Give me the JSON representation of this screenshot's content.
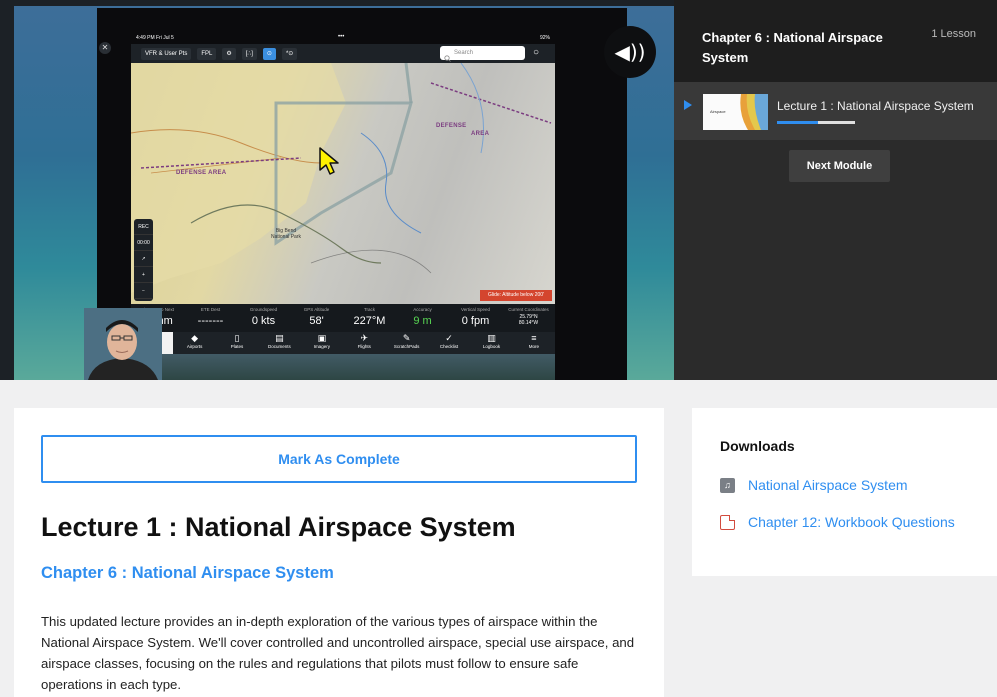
{
  "video": {
    "ipad": {
      "time": "4:49 PM  Fri Jul 5",
      "battery": "92%",
      "toolbar": [
        "VFR & User Pts",
        "FPL",
        "⚙",
        "[∴]",
        "⊙",
        "*⊙"
      ],
      "search_placeholder": "Search",
      "map_labels": {
        "defense_area_1": "DEFENSE AREA",
        "defense_area_2": "DEFENSE",
        "area": "AREA",
        "park": "Big Bend National Park"
      },
      "controls": [
        "REC",
        "00:00",
        "↗",
        "+",
        "−"
      ],
      "glide_warning": "Glide: Altitude below 200'",
      "instruments": [
        {
          "label": "Distance to Next",
          "value": "81 nm"
        },
        {
          "label": "ETE Dest",
          "value": "-------"
        },
        {
          "label": "Groundspeed",
          "value": "0 kts"
        },
        {
          "label": "GPS Altitude",
          "value": "58'"
        },
        {
          "label": "Track",
          "value": "227°M"
        },
        {
          "label": "Accuracy",
          "value": "9 m"
        },
        {
          "label": "Vertical Speed",
          "value": "0 fpm"
        },
        {
          "label": "Current Coordinates",
          "value": "25.79°N\n80.14°W"
        }
      ],
      "tabs": [
        "Maps",
        "Airports",
        "Plates",
        "Documents",
        "Imagery",
        "Flights",
        "ScratchPads",
        "Checklist",
        "Logbook",
        "More"
      ]
    },
    "volume_icon": "speaker-icon",
    "volume_glyph": "◀))"
  },
  "sidebar": {
    "chapter_title": "Chapter 6 : National Airspace System",
    "lesson_count": "1 Lesson",
    "lessons": [
      {
        "title": "Lecture 1 : National Airspace System",
        "progress": 0.52,
        "thumb_text": "Airspace"
      }
    ],
    "next_module_label": "Next Module"
  },
  "main": {
    "mark_complete_label": "Mark As Complete",
    "lecture_title": "Lecture 1 : National Airspace System",
    "chapter_subtitle": "Chapter 6 : National Airspace System",
    "description": "This updated lecture provides an in-depth exploration of the various types of airspace within the National Airspace System. We'll cover controlled and uncontrolled airspace, special use airspace, and airspace classes, focusing on the rules and regulations that pilots must follow to ensure safe operations in each type."
  },
  "downloads": {
    "heading": "Downloads",
    "items": [
      {
        "name": "National Airspace System",
        "icon": "audio-file-icon"
      },
      {
        "name": "Chapter 12: Workbook Questions",
        "icon": "pdf-file-icon"
      }
    ]
  },
  "colors": {
    "accent": "#2f8ef0",
    "sidebar_bg": "#2b2b2b",
    "warning": "#d4452e",
    "green": "#58d653"
  }
}
